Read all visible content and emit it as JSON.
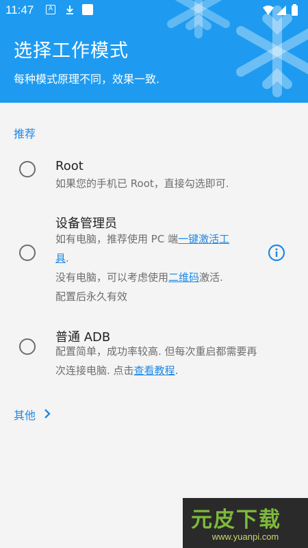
{
  "status_bar": {
    "time": "11:47",
    "a_icon_label": "A"
  },
  "header": {
    "title": "选择工作模式",
    "subtitle": "每种模式原理不同，效果一致.",
    "bg_color": "#1e9bf0"
  },
  "section": {
    "label": "推荐"
  },
  "options": [
    {
      "title": "Root",
      "desc": "如果您的手机已 Root，直接勾选即可.",
      "selected": false
    },
    {
      "title": "设备管理员",
      "desc_a": "如有电脑，推荐使用 PC 端",
      "link_a": "一键激活工",
      "link_a2": "具",
      "desc_a_end": ".",
      "desc_b": "没有电脑，可以考虑使用",
      "link_b": "二维码",
      "desc_b_end": "激活.",
      "desc_c": "配置后永久有效",
      "selected": false
    },
    {
      "title": "普通 ADB",
      "desc_a": "配置简单，成功率较高. 但每次重启都需要再",
      "desc_b": "次连接电脑. 点击",
      "link": "查看教程",
      "desc_end": ".",
      "selected": false
    }
  ],
  "more": {
    "label": "其他"
  },
  "watermark": {
    "brand": "元皮下载",
    "url": "www.yuanpi.com"
  },
  "icons": [
    "a-notification-icon",
    "download-icon",
    "app-notification-icon",
    "wifi-icon",
    "signal-icon",
    "battery-icon",
    "info-icon",
    "chevron-right-icon",
    "snowflake-icon"
  ],
  "colors": {
    "accent": "#1e88e5",
    "header": "#1e9bf0",
    "background": "#f4f4f4"
  }
}
